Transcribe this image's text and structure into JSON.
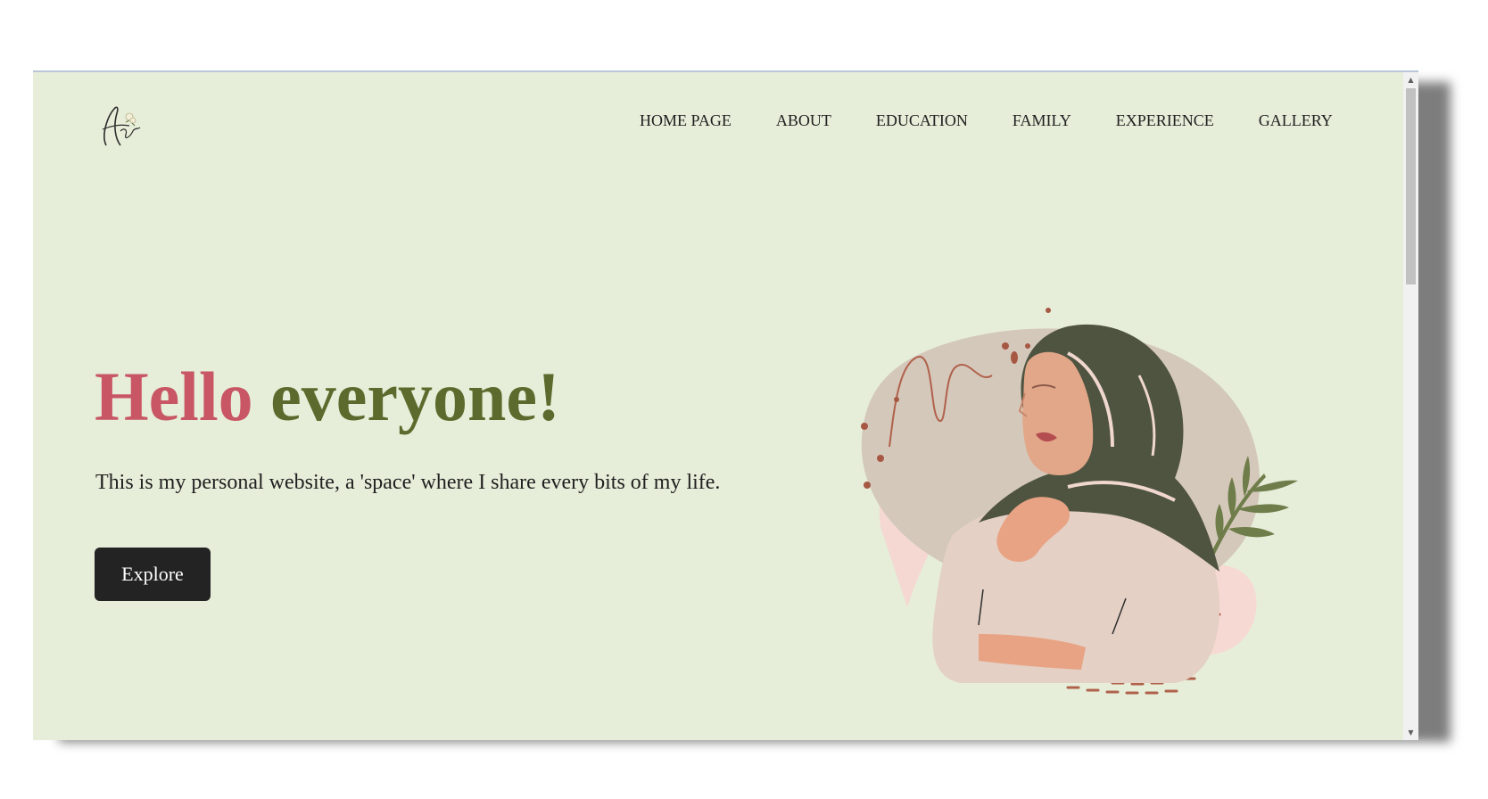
{
  "nav": {
    "items": [
      {
        "label": "HOME PAGE"
      },
      {
        "label": "ABOUT"
      },
      {
        "label": "EDUCATION"
      },
      {
        "label": "FAMILY"
      },
      {
        "label": "EXPERIENCE"
      },
      {
        "label": "GALLERY"
      }
    ]
  },
  "hero": {
    "title_part1": "Hello",
    "title_part2": "everyone!",
    "subtitle": "This is my personal website, a 'space' where I share every bits of my life.",
    "button_label": "Explore"
  },
  "colors": {
    "background": "#e6eed9",
    "accent_pink": "#c85665",
    "accent_olive": "#5c6b2d",
    "button_dark": "#232323",
    "hijab_green": "#4f5440"
  },
  "icons": {
    "logo": "signature-logo-icon",
    "illustration": "hijab-woman-illustration",
    "scroll_up": "scroll-up-arrow-icon",
    "scroll_down": "scroll-down-arrow-icon"
  }
}
